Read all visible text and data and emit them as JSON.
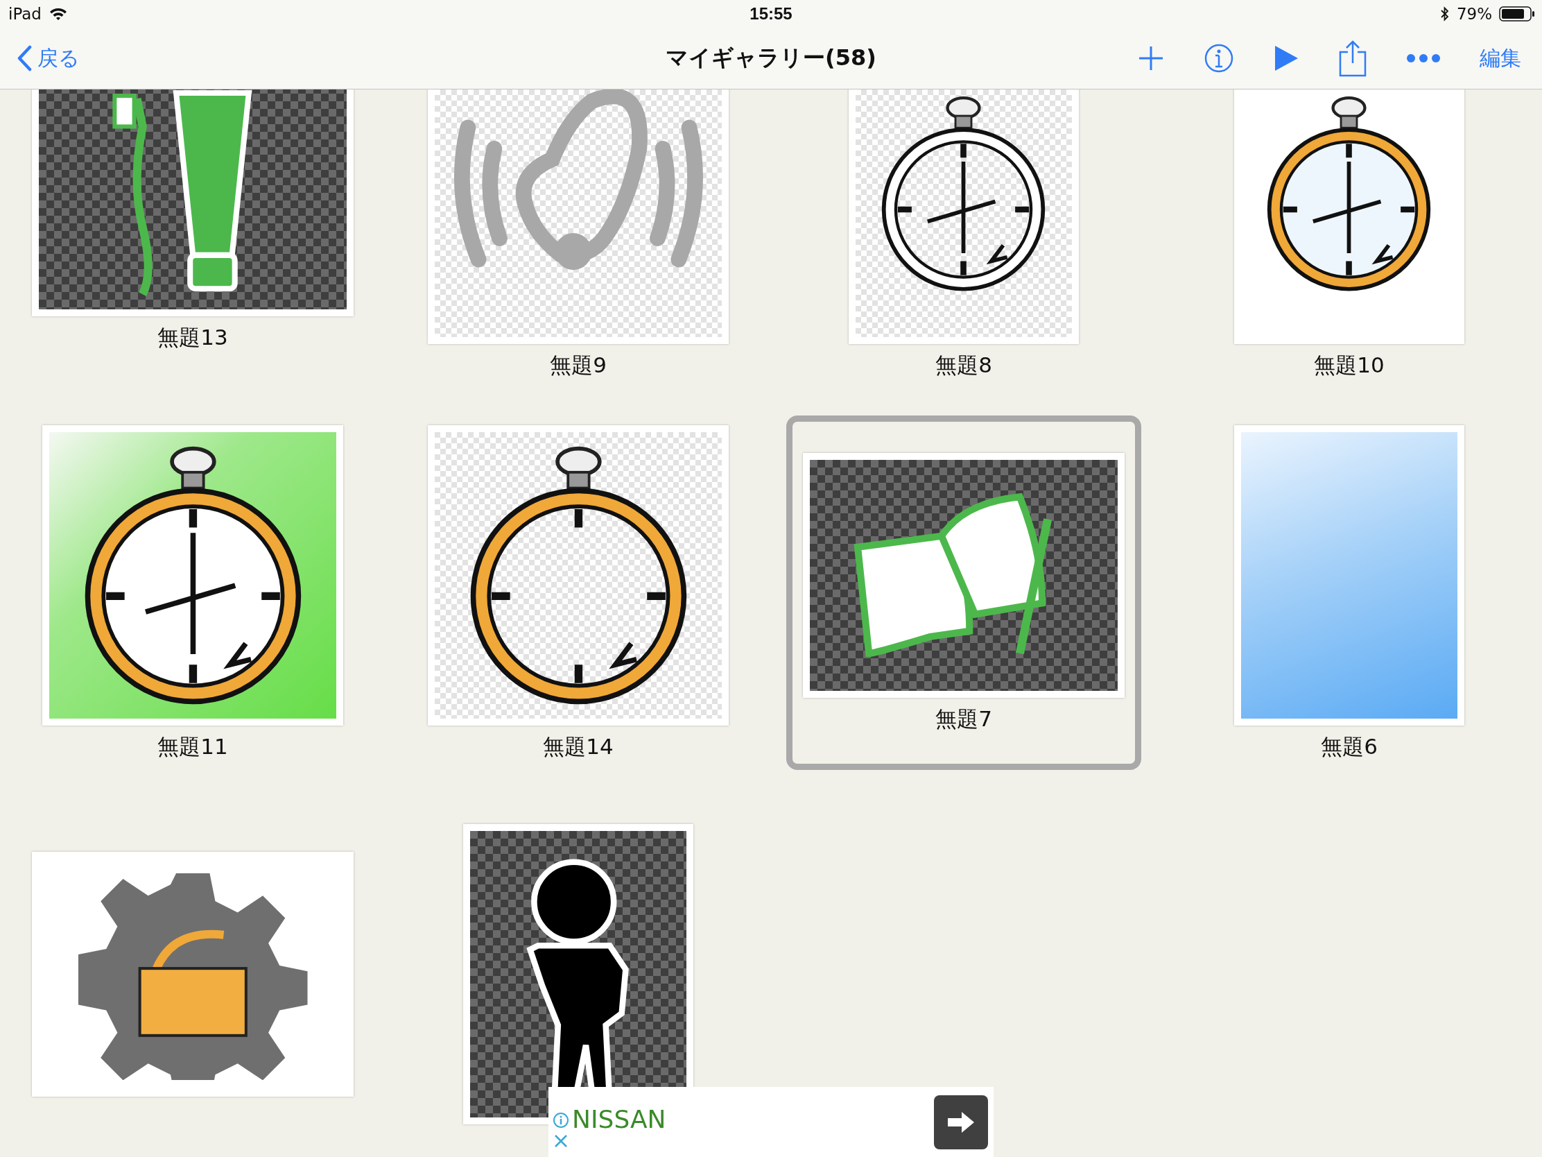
{
  "status_bar": {
    "device": "iPad",
    "time": "15:55",
    "battery": "79%"
  },
  "nav": {
    "back": "戻る",
    "title": "マイギャラリー(58)",
    "edit": "編集"
  },
  "items": [
    {
      "label": "無題13",
      "kind": "toothbrush",
      "selected": false
    },
    {
      "label": "無題9",
      "kind": "bell",
      "selected": false
    },
    {
      "label": "無題8",
      "kind": "stopwatch",
      "selected": false
    },
    {
      "label": "無題10",
      "kind": "bluewatch",
      "selected": false
    },
    {
      "label": "無題11",
      "kind": "greenwatch",
      "selected": false
    },
    {
      "label": "無題14",
      "kind": "ringwatch",
      "selected": false
    },
    {
      "label": "無題7",
      "kind": "book",
      "selected": true
    },
    {
      "label": "無題6",
      "kind": "gradient",
      "selected": false
    },
    {
      "kind": "gearlock",
      "selected": false
    },
    {
      "kind": "figure",
      "selected": false
    }
  ],
  "ad": {
    "brand": "NISSAN"
  }
}
